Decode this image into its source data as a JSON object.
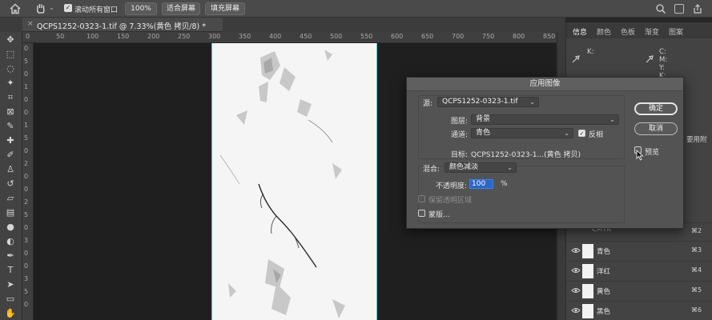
{
  "options_bar": {
    "scroll_all_label": "滚动所有窗口",
    "zoom_100": "100%",
    "fit_screen": "适合屏幕",
    "fill_screen": "填充屏幕"
  },
  "document": {
    "tab_title": "QCPS1252-0323-1.tif @ 7.33%(黄色 拷贝/8) *",
    "close_symbol": "×",
    "ruler_h": [
      "0",
      "50",
      "100",
      "150",
      "200",
      "250",
      "300",
      "350",
      "400",
      "450",
      "500",
      "550",
      "600",
      "650",
      "700",
      "750",
      "800",
      "850"
    ],
    "ruler_v": [
      "0",
      "5",
      "0",
      "1",
      "0",
      "0",
      "1",
      "5",
      "0",
      "2",
      "0",
      "0",
      "2",
      "5",
      "0",
      "3",
      "0",
      "0",
      "3",
      "5",
      "0"
    ]
  },
  "panel": {
    "tabs": [
      "信息",
      "颜色",
      "色板",
      "渐变",
      "图案"
    ],
    "info_k": "K:",
    "info_cmyk": [
      "C:",
      "M:",
      "Y:",
      "K:"
    ],
    "clipped_text": "要用附",
    "channels": [
      {
        "name": "CMYK",
        "shortcut": "⌘2"
      },
      {
        "name": "青色",
        "shortcut": "⌘3"
      },
      {
        "name": "洋红",
        "shortcut": "⌘4"
      },
      {
        "name": "黄色",
        "shortcut": "⌘5"
      },
      {
        "name": "黑色",
        "shortcut": "⌘6"
      }
    ]
  },
  "dialog": {
    "title": "应用图像",
    "source_label": "源:",
    "source_value": "QCPS1252-0323-1.tif",
    "layer_label": "图层:",
    "layer_value": "背景",
    "channel_label": "通道:",
    "channel_value": "青色",
    "invert_label": "反相",
    "target_label": "目标:",
    "target_value": "QCPS1252-0323-1...(黄色 拷贝)",
    "blend_label": "混合:",
    "blend_value": "颜色减淡",
    "opacity_label": "不透明度:",
    "opacity_value": "100",
    "opacity_unit": "%",
    "preserve_transparency": "保留透明区域",
    "mask_label": "蒙版...",
    "ok": "确定",
    "cancel": "取消",
    "preview": "预览"
  }
}
